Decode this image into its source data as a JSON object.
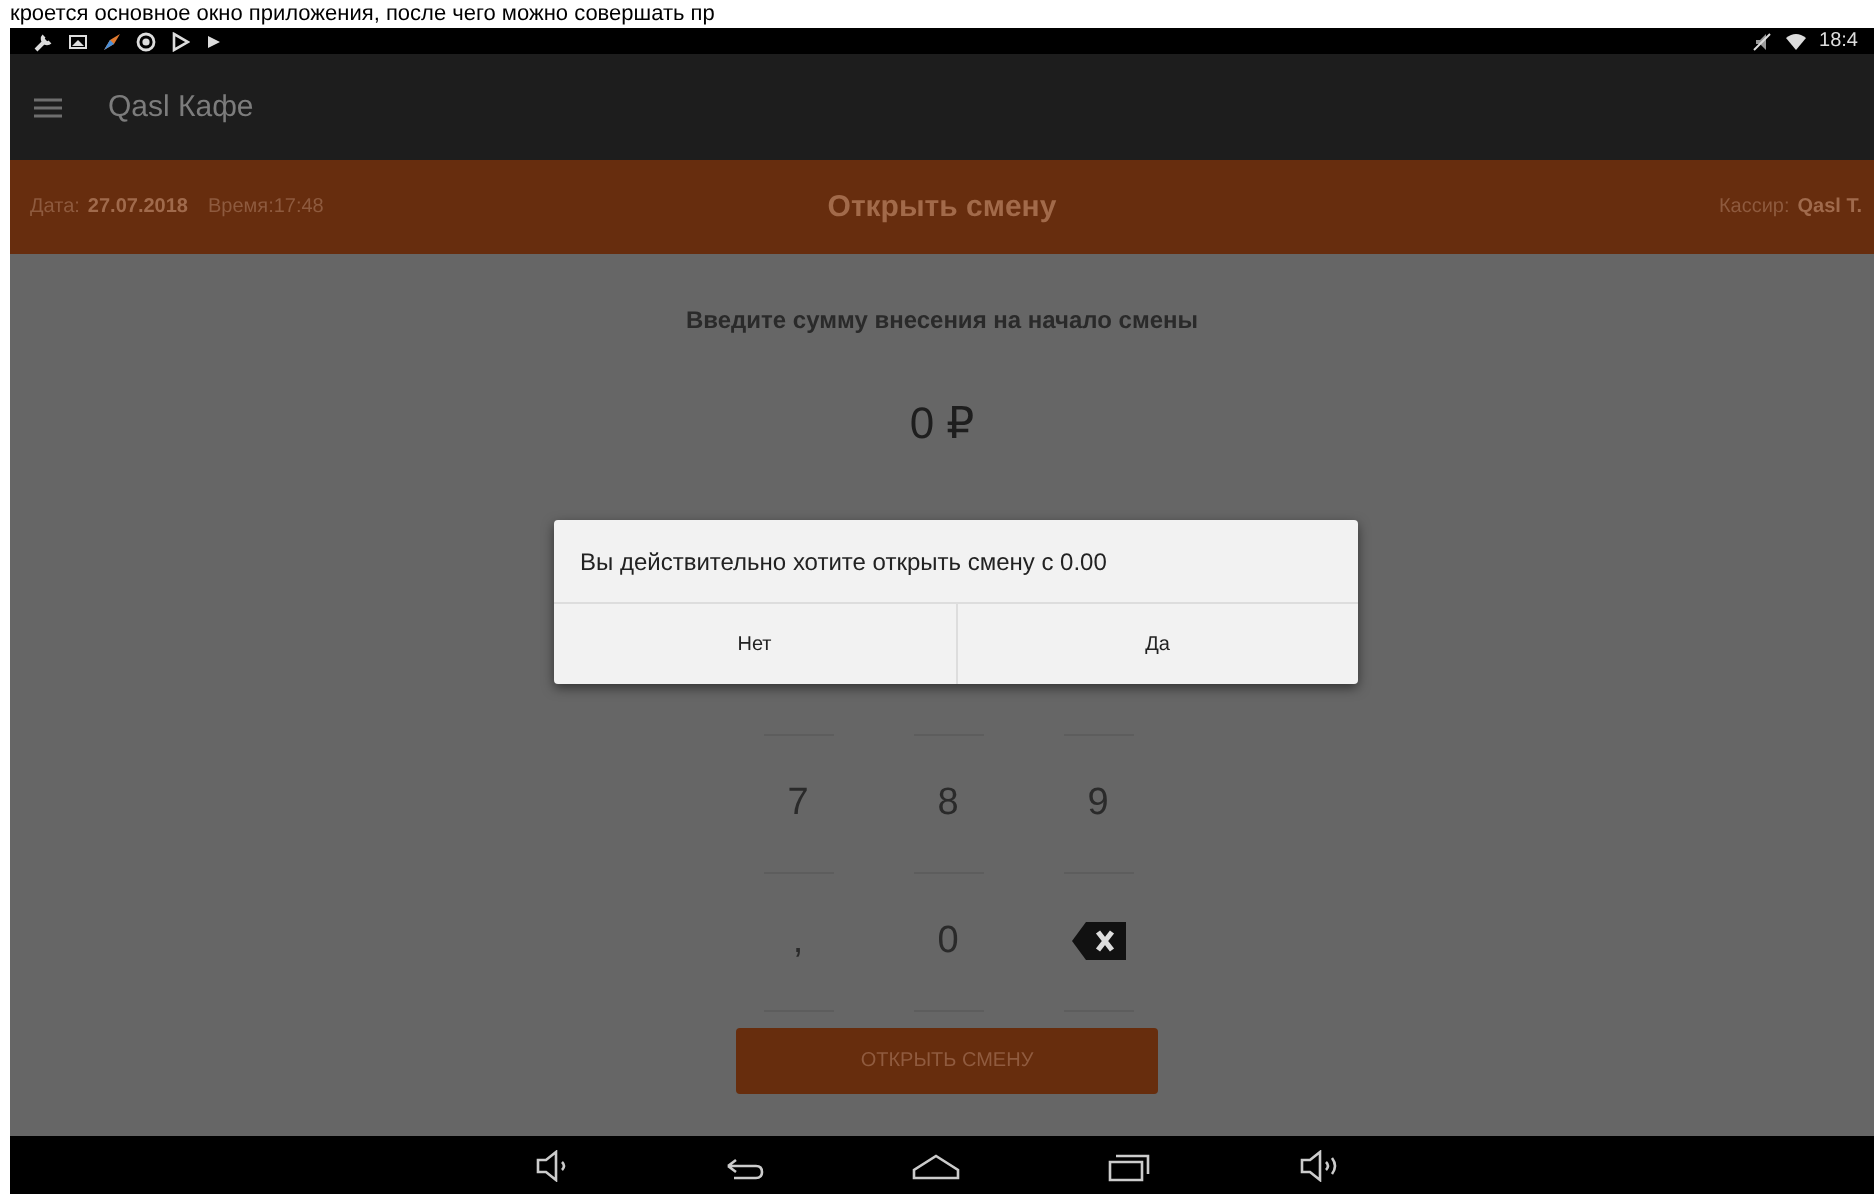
{
  "caption": "кроется основное окно приложения, после чего можно совершать пр",
  "status_bar": {
    "time": "18:4"
  },
  "app_bar": {
    "title": "Qasl Кафе"
  },
  "shift_bar": {
    "date_label": "Дата:",
    "date": "27.07.2018",
    "time": "Время:17:48",
    "title": "Открыть смену",
    "cashier_label": "Кассир:",
    "cashier": "Qasl T."
  },
  "prompt": "Введите сумму внесения на начало смены",
  "amount": "0 ₽",
  "keypad": [
    [
      {
        "kind": "digit",
        "label": "7"
      },
      {
        "kind": "digit",
        "label": "8"
      },
      {
        "kind": "digit",
        "label": "9"
      }
    ],
    [
      {
        "kind": "digit",
        "label": ","
      },
      {
        "kind": "digit",
        "label": "0"
      },
      {
        "kind": "backspace"
      }
    ]
  ],
  "open_button": "ОТКРЫТЬ СМЕНУ",
  "dialog": {
    "message": "Вы действительно хотите открыть смену с 0.00",
    "buttons": [
      "Нет",
      "Да"
    ]
  }
}
